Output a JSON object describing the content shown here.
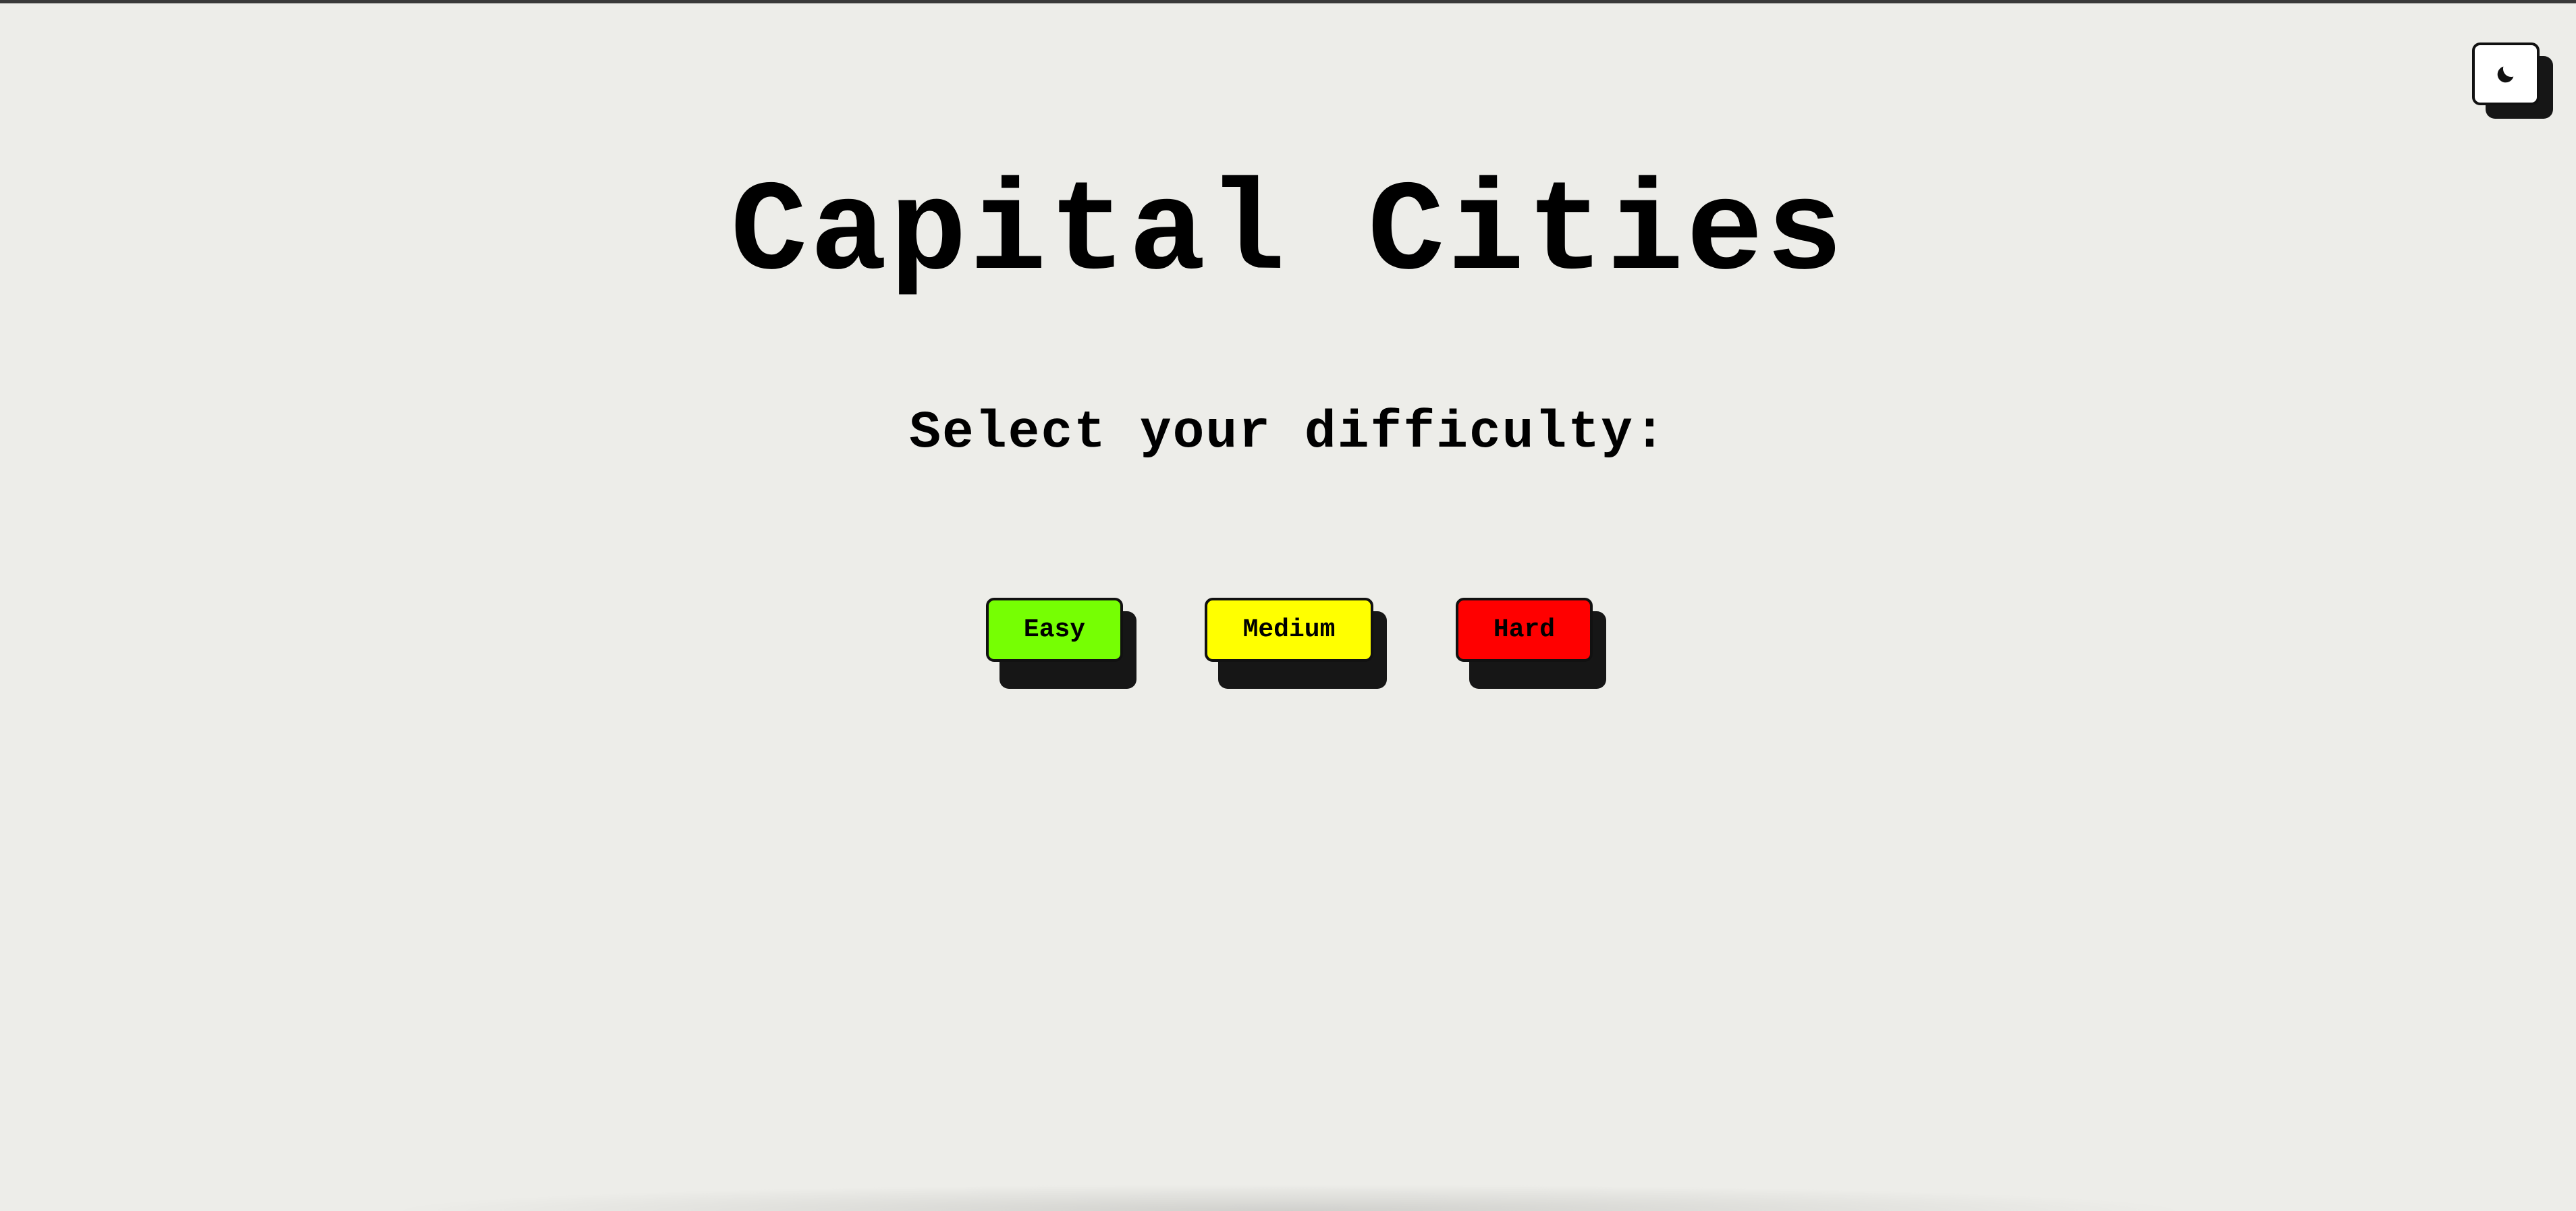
{
  "header": {
    "theme_toggle": {
      "icon": "moon-icon",
      "background": "#ffffff"
    }
  },
  "main": {
    "title": "Capital Cities",
    "subtitle": "Select your difficulty:",
    "difficulty_buttons": [
      {
        "label": "Easy",
        "color": "#76ff03"
      },
      {
        "label": "Medium",
        "color": "#ffff00"
      },
      {
        "label": "Hard",
        "color": "#ff0000"
      }
    ]
  },
  "colors": {
    "background": "#edede9",
    "border": "#111111",
    "shadow": "#161616"
  }
}
